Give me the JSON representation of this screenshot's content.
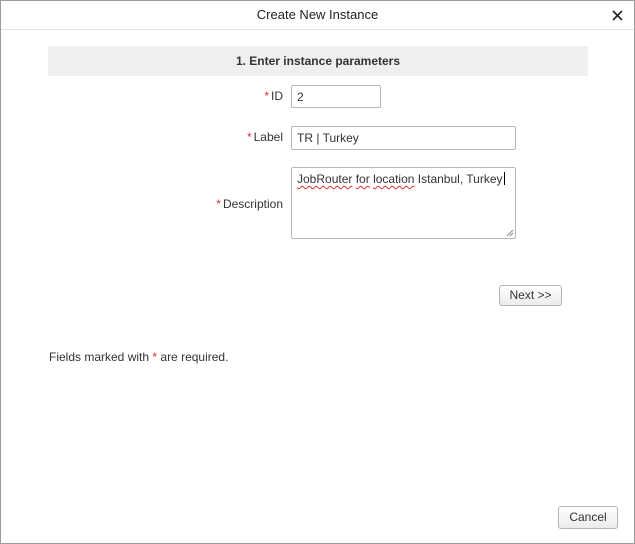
{
  "dialog": {
    "title": "Create New Instance",
    "close_icon": "close-icon"
  },
  "section": {
    "title": "1. Enter instance parameters"
  },
  "form": {
    "required_marker": "*",
    "id": {
      "label": "ID",
      "value": "2"
    },
    "label": {
      "label": "Label",
      "value": "TR | Turkey"
    },
    "description": {
      "label": "Description",
      "value_parts": [
        "JobRouter",
        " ",
        "for",
        " ",
        "location",
        " Istanbul, Turkey"
      ]
    }
  },
  "buttons": {
    "next": "Next >>",
    "cancel": "Cancel"
  },
  "note": {
    "before": "Fields marked with",
    "marker": "*",
    "after": "are required."
  },
  "colors": {
    "required": "#e0302f",
    "section_bg": "#efefef"
  }
}
